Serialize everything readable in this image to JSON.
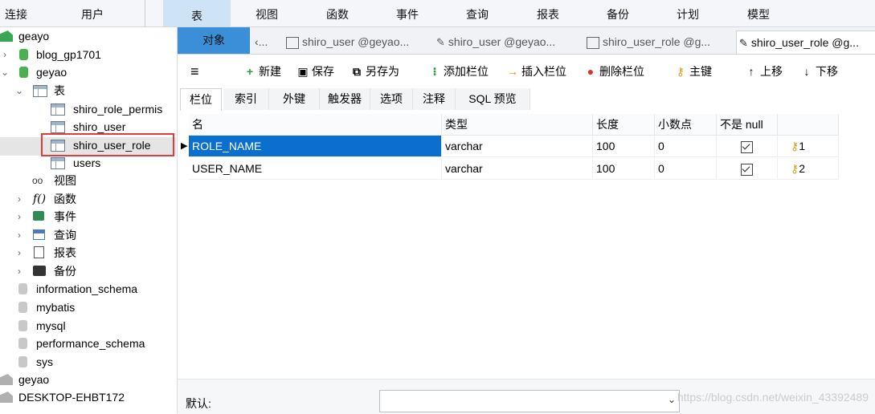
{
  "topmenu": {
    "items": [
      "连接",
      "用户",
      "表",
      "视图",
      "函数",
      "事件",
      "查询",
      "报表",
      "备份",
      "计划",
      "模型"
    ],
    "active_index": 2
  },
  "tree": {
    "nodes": [
      {
        "label": "geayo",
        "icon": "connection-icon"
      },
      {
        "label": "blog_gp1701",
        "icon": "database-icon"
      },
      {
        "label": "geyao",
        "icon": "database-icon"
      },
      {
        "label": "表",
        "icon": "tables-folder-icon"
      },
      {
        "label": "shiro_role_permis",
        "icon": "table-icon"
      },
      {
        "label": "shiro_user",
        "icon": "table-icon"
      },
      {
        "label": "shiro_user_role",
        "icon": "table-icon"
      },
      {
        "label": "users",
        "icon": "table-icon"
      },
      {
        "label": "视图",
        "icon": "views-icon"
      },
      {
        "label": "函数",
        "icon": "function-icon"
      },
      {
        "label": "事件",
        "icon": "event-icon"
      },
      {
        "label": "查询",
        "icon": "query-icon"
      },
      {
        "label": "报表",
        "icon": "report-icon"
      },
      {
        "label": "备份",
        "icon": "backup-icon"
      },
      {
        "label": "information_schema",
        "icon": "database-icon"
      },
      {
        "label": "mybatis",
        "icon": "database-icon"
      },
      {
        "label": "mysql",
        "icon": "database-icon"
      },
      {
        "label": "performance_schema",
        "icon": "database-icon"
      },
      {
        "label": "sys",
        "icon": "database-icon"
      },
      {
        "label": "geyao",
        "icon": "connection-icon"
      },
      {
        "label": "DESKTOP-EHBT172",
        "icon": "connection-icon"
      }
    ]
  },
  "tabs": {
    "object": "对象",
    "items": [
      "...",
      "shiro_user @geyao...",
      "shiro_user @geyao...",
      "shiro_user_role @g...",
      "shiro_user_role @g..."
    ]
  },
  "toolbar": {
    "new": "新建",
    "save": "保存",
    "save_as": "另存为",
    "add_field": "添加栏位",
    "insert_field": "插入栏位",
    "delete_field": "删除栏位",
    "primary_key": "主键",
    "move_up": "上移",
    "move_down": "下移"
  },
  "subtabs": [
    "栏位",
    "索引",
    "外键",
    "触发器",
    "选项",
    "注释",
    "SQL 预览"
  ],
  "grid": {
    "headers": [
      "名",
      "类型",
      "长度",
      "小数点",
      "不是 null",
      ""
    ],
    "rows": [
      {
        "name": "ROLE_NAME",
        "type": "varchar",
        "length": "100",
        "decimals": "0",
        "not_null": true,
        "key": "1"
      },
      {
        "name": "USER_NAME",
        "type": "varchar",
        "length": "100",
        "decimals": "0",
        "not_null": true,
        "key": "2"
      }
    ]
  },
  "bottom": {
    "default_label": "默认:"
  },
  "watermark": "https://blog.csdn.net/weixin_43392489",
  "colors": {
    "accent": "#3b8fd8",
    "selection": "#0a6fcf",
    "highlight_box": "#e23b3b"
  }
}
